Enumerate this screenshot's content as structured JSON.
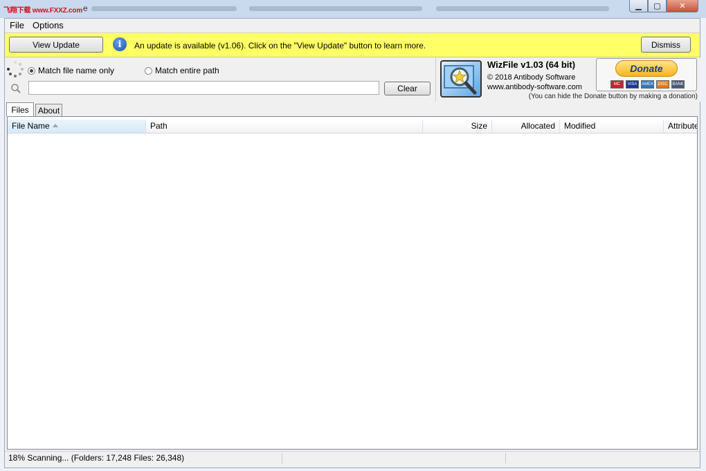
{
  "window": {
    "title_watermark": "飞翔下载 www.FXXZ.com",
    "title_suffix": "e",
    "minimize_glyph": "▁",
    "maximize_glyph": "▢",
    "close_glyph": "✕"
  },
  "menu": {
    "items": [
      {
        "label": "File"
      },
      {
        "label": "Options"
      }
    ]
  },
  "update_bar": {
    "view_update_label": "View Update",
    "info_glyph": "i",
    "message": "An update is available (v1.06). Click on the \"View Update\" button to learn more.",
    "dismiss_label": "Dismiss",
    "background_color": "#ffff66"
  },
  "search": {
    "mode_options": [
      {
        "label": "Match file name only",
        "selected": true
      },
      {
        "label": "Match entire path",
        "selected": false
      }
    ],
    "query_value": "",
    "clear_label": "Clear"
  },
  "about": {
    "title": "WizFile v1.03 (64 bit)",
    "copyright": "© 2018 Antibody Software",
    "website": "www.antibody-software.com",
    "donate_label": "Donate",
    "donate_note": "(You can hide the Donate button by making a donation)",
    "payment_cards": [
      {
        "name": "mastercard",
        "label": "MC",
        "color": "#c8232c"
      },
      {
        "name": "visa",
        "label": "VISA",
        "color": "#1a3a8f"
      },
      {
        "name": "amex",
        "label": "AMEX",
        "color": "#2e77bb"
      },
      {
        "name": "discover",
        "label": "DISC",
        "color": "#e47a1c"
      },
      {
        "name": "bank",
        "label": "BANK",
        "color": "#4a5a78"
      }
    ]
  },
  "tabs": [
    {
      "label": "Files",
      "active": true
    },
    {
      "label": "About",
      "active": false
    }
  ],
  "list": {
    "columns": [
      {
        "label": "File Name",
        "sorted": "ascending"
      },
      {
        "label": "Path"
      },
      {
        "label": "Size"
      },
      {
        "label": "Allocated"
      },
      {
        "label": "Modified"
      },
      {
        "label": "Attribute"
      }
    ],
    "rows": []
  },
  "status": {
    "text": "18% Scanning... (Folders: 17,248  Files: 26,348)",
    "scan_progress_percent": 18,
    "folders_scanned": 17248,
    "files_scanned": 26348
  }
}
